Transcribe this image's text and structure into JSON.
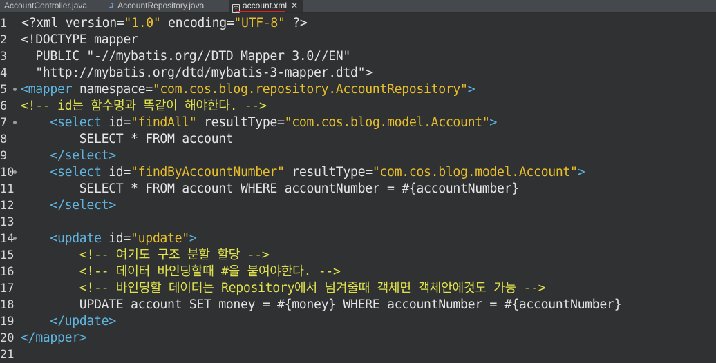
{
  "tabs": [
    {
      "label": "AccountController.java",
      "active": false
    },
    {
      "label": "AccountRepository.java",
      "active": false,
      "icon": "J"
    },
    {
      "label": "account.xml",
      "active": true
    }
  ],
  "lines": [
    {
      "n": "1",
      "fold": false,
      "segs": [
        [
          "p",
          "<"
        ],
        [
          "p",
          "?xml version="
        ],
        [
          "s",
          "\"1.0\""
        ],
        [
          "p",
          " encoding="
        ],
        [
          "s",
          "\"UTF-8\""
        ],
        [
          "p",
          " ?>"
        ]
      ]
    },
    {
      "n": "2",
      "fold": false,
      "segs": [
        [
          "p",
          "<!DOCTYPE mapper"
        ]
      ]
    },
    {
      "n": "3",
      "fold": false,
      "segs": [
        [
          "p",
          "  PUBLIC \"-//mybatis.org//DTD Mapper 3.0//EN\""
        ]
      ]
    },
    {
      "n": "4",
      "fold": false,
      "segs": [
        [
          "p",
          "  \"http://mybatis.org/dtd/mybatis-3-mapper.dtd\">"
        ]
      ]
    },
    {
      "n": "5",
      "fold": true,
      "segs": [
        [
          "t",
          "<mapper "
        ],
        [
          "a",
          "namespace="
        ],
        [
          "s",
          "\"com.cos.blog.repository.AccountRepository\""
        ],
        [
          "t",
          ">"
        ]
      ]
    },
    {
      "n": "6",
      "fold": false,
      "segs": [
        [
          "cm",
          "<!-- id는 함수명과 똑같이 해야한다. -->"
        ]
      ]
    },
    {
      "n": "7",
      "fold": true,
      "segs": [
        [
          "t",
          "    <select "
        ],
        [
          "a",
          "id="
        ],
        [
          "s",
          "\"findAll\""
        ],
        [
          "a",
          " resultType="
        ],
        [
          "s",
          "\"com.cos.blog.model.Account\""
        ],
        [
          "t",
          ">"
        ]
      ]
    },
    {
      "n": "8",
      "fold": false,
      "segs": [
        [
          "p",
          "        SELECT * FROM account"
        ]
      ]
    },
    {
      "n": "9",
      "fold": false,
      "segs": [
        [
          "t",
          "    </select>"
        ]
      ]
    },
    {
      "n": "10",
      "fold": true,
      "segs": [
        [
          "t",
          "    <select "
        ],
        [
          "a",
          "id="
        ],
        [
          "s",
          "\"findByAccountNumber\""
        ],
        [
          "a",
          " resultType="
        ],
        [
          "s",
          "\"com.cos.blog.model.Account\""
        ],
        [
          "t",
          ">"
        ]
      ]
    },
    {
      "n": "11",
      "fold": false,
      "segs": [
        [
          "p",
          "        SELECT * FROM account WHERE accountNumber = #{accountNumber}"
        ]
      ]
    },
    {
      "n": "12",
      "fold": false,
      "segs": [
        [
          "t",
          "    </select>"
        ]
      ]
    },
    {
      "n": "13",
      "fold": false,
      "segs": [
        [
          "p",
          ""
        ]
      ]
    },
    {
      "n": "14",
      "fold": true,
      "segs": [
        [
          "t",
          "    <update "
        ],
        [
          "a",
          "id="
        ],
        [
          "s",
          "\"update\""
        ],
        [
          "t",
          ">"
        ]
      ]
    },
    {
      "n": "15",
      "fold": false,
      "segs": [
        [
          "cm",
          "        <!-- 여기도 구조 분할 할당 -->"
        ]
      ]
    },
    {
      "n": "16",
      "fold": false,
      "segs": [
        [
          "cm",
          "        <!-- 데이터 바인딩할때 #을 붙여야한다. -->"
        ]
      ]
    },
    {
      "n": "17",
      "fold": false,
      "segs": [
        [
          "cm",
          "        <!-- 바인딩할 데이터는 Repository에서 넘겨줄때 객체면 객체안에것도 가능 -->"
        ]
      ]
    },
    {
      "n": "18",
      "fold": false,
      "segs": [
        [
          "p",
          "        UPDATE account SET money = #{money} WHERE accountNumber = #{accountNumber}"
        ]
      ]
    },
    {
      "n": "19",
      "fold": false,
      "segs": [
        [
          "t",
          "    </update>"
        ]
      ]
    },
    {
      "n": "20",
      "fold": false,
      "segs": [
        [
          "t",
          "</mapper>"
        ]
      ]
    },
    {
      "n": "21",
      "fold": false,
      "segs": [
        [
          "p",
          ""
        ]
      ]
    }
  ]
}
